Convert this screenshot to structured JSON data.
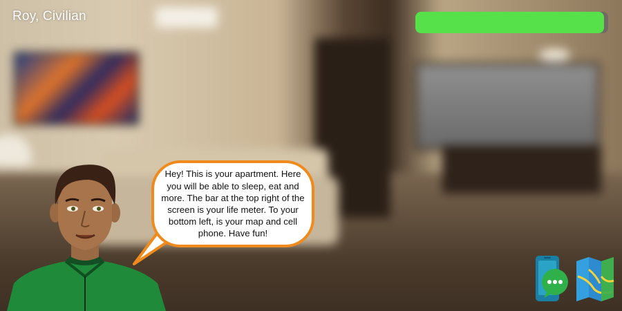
{
  "hud": {
    "player_label": "Roy, Civilian",
    "life_level": 0.98,
    "life_color": "#56e04a"
  },
  "dialogue": {
    "text": "Hey! This is your apartment. Here you will be able to sleep, eat and more. The bar at the top right of the screen is your life meter. To your bottom left, is your map and cell phone. Have fun!",
    "border_color": "#f08a1c"
  },
  "icons": {
    "phone": "cell-phone-chat-icon",
    "map": "folded-map-icon"
  }
}
